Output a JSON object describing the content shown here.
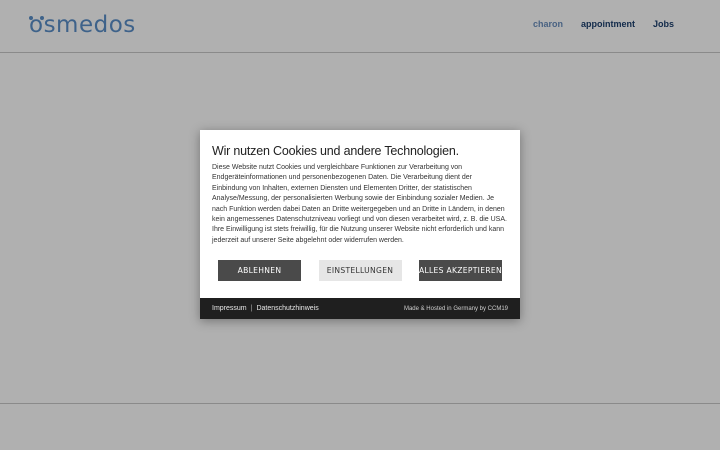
{
  "header": {
    "logo_text": "smedos",
    "logo_mark": "o",
    "nav": [
      {
        "label": "charon"
      },
      {
        "label": "appointment"
      },
      {
        "label": "Jobs"
      }
    ]
  },
  "cookie_dialog": {
    "title": "Wir nutzen Cookies und andere Technologien.",
    "text": "Diese Website nutzt Cookies und vergleichbare Funktionen zur Verarbeitung von Endgeräteinformationen und personenbezogenen Daten. Die Verarbeitung dient der Einbindung von Inhalten, externen Diensten und Elementen Dritter, der statistischen Analyse/Messung, der personalisierten Werbung sowie der Einbindung sozialer Medien. Je nach Funktion werden dabei Daten an Dritte weitergegeben und an Dritte in Ländern, in denen kein angemessenes Datenschutzniveau vorliegt und von diesen verarbeitet wird, z. B. die USA. Ihre Einwilligung ist stets freiwillig, für die Nutzung unserer Website nicht erforderlich und kann jederzeit auf unserer Seite abgelehnt oder widerrufen werden.",
    "buttons": {
      "reject": "ABLEHNEN",
      "settings": "EINSTELLUNGEN",
      "accept_all": "ALLES AKZEPTIEREN"
    },
    "footer": {
      "imprint": "Impressum",
      "separator": "|",
      "privacy": "Datenschutzhinweis",
      "credit": "Made & Hosted in Germany by CCM19"
    }
  },
  "colors": {
    "brand_blue": "#5a8fc8",
    "nav_dark": "#1c3f6d",
    "button_dark": "#4a4a4a",
    "footer_bg": "#1f1f1f"
  }
}
